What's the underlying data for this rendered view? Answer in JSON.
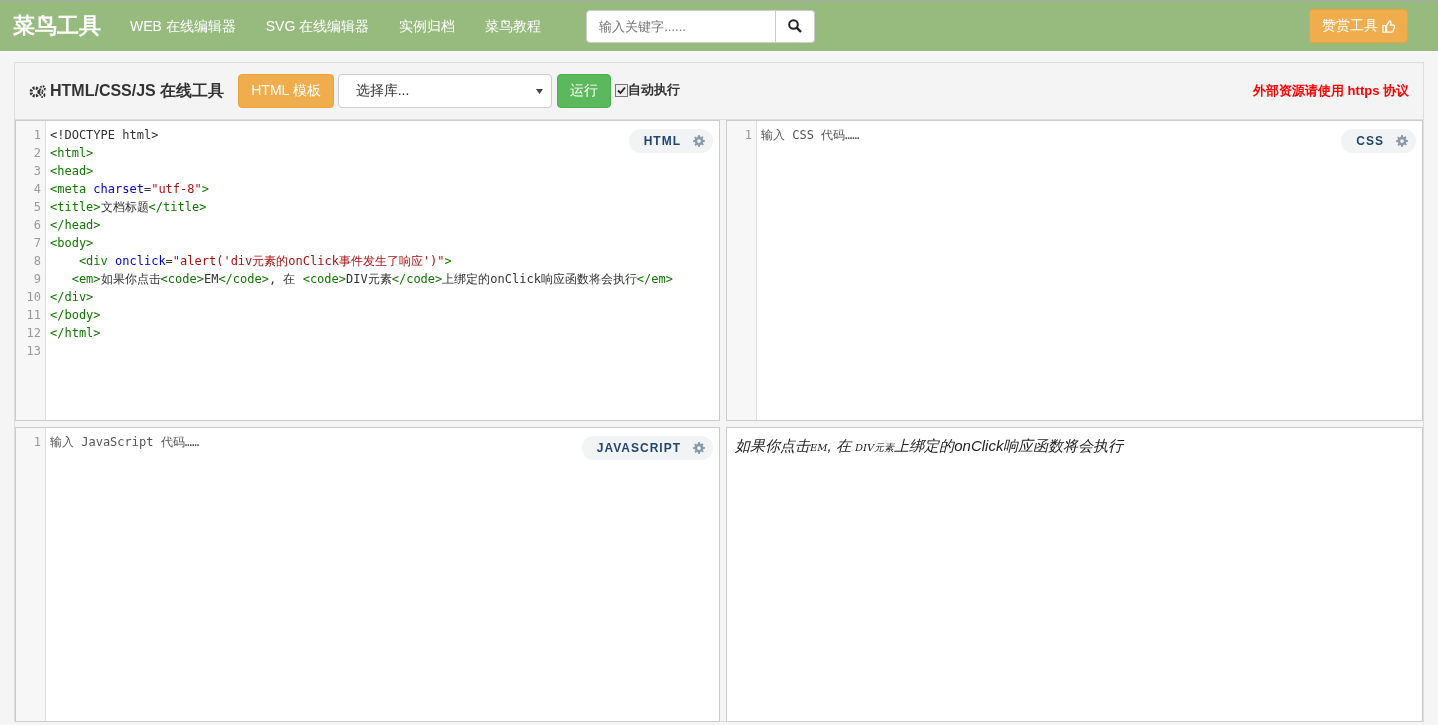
{
  "header": {
    "logo": "菜鸟工具",
    "nav": [
      {
        "label": "WEB 在线编辑器"
      },
      {
        "label": "SVG 在线编辑器"
      },
      {
        "label": "实例归档"
      },
      {
        "label": "菜鸟教程"
      }
    ],
    "search": {
      "placeholder": "输入关键字......"
    },
    "donate_button": "赞赏工具"
  },
  "toolbar": {
    "title": "HTML/CSS/JS 在线工具",
    "template_button": "HTML 模板",
    "library_select": "选择库...",
    "run_button": "运行",
    "auto_run": {
      "label": "自动执行",
      "checked": true
    },
    "notice": "外部资源请使用 https 协议"
  },
  "editors": [
    {
      "label": "HTML",
      "lines": [
        {
          "number": "1",
          "tokens": [
            {
              "kind": "text",
              "text": "<!DOCTYPE html>"
            }
          ]
        },
        {
          "number": "2",
          "tokens": [
            {
              "kind": "tag",
              "text": "<html>"
            }
          ]
        },
        {
          "number": "3",
          "tokens": [
            {
              "kind": "tag",
              "text": "<head>"
            }
          ]
        },
        {
          "number": "4",
          "tokens": [
            {
              "kind": "tag",
              "text": "<meta "
            },
            {
              "kind": "attr",
              "text": "charset"
            },
            {
              "kind": "text",
              "text": "="
            },
            {
              "kind": "string",
              "text": "\"utf-8\""
            },
            {
              "kind": "tag",
              "text": ">"
            }
          ]
        },
        {
          "number": "5",
          "tokens": [
            {
              "kind": "tag",
              "text": "<title>"
            },
            {
              "kind": "text",
              "text": "文档标题"
            },
            {
              "kind": "tag",
              "text": "</title>"
            }
          ]
        },
        {
          "number": "6",
          "tokens": [
            {
              "kind": "tag",
              "text": "</head>"
            }
          ]
        },
        {
          "number": "7",
          "tokens": [
            {
              "kind": "tag",
              "text": "<body>"
            }
          ]
        },
        {
          "number": "8",
          "tokens": [
            {
              "kind": "tag",
              "text": "    <div "
            },
            {
              "kind": "attr",
              "text": "onclick"
            },
            {
              "kind": "text",
              "text": "="
            },
            {
              "kind": "string",
              "text": "\"alert('div元素的onClick事件发生了响应')\""
            },
            {
              "kind": "tag",
              "text": ">"
            }
          ]
        },
        {
          "number": "9",
          "tokens": [
            {
              "kind": "tag",
              "text": "   <em>"
            },
            {
              "kind": "text",
              "text": "如果你点击"
            },
            {
              "kind": "tag",
              "text": "<code>"
            },
            {
              "kind": "text",
              "text": "EM"
            },
            {
              "kind": "tag",
              "text": "</code>"
            },
            {
              "kind": "text",
              "text": ", 在 "
            },
            {
              "kind": "tag",
              "text": "<code>"
            },
            {
              "kind": "text",
              "text": "DIV元素"
            },
            {
              "kind": "tag",
              "text": "</code>"
            },
            {
              "kind": "text",
              "text": "上绑定的onClick响应函数将会执行"
            },
            {
              "kind": "tag",
              "text": "</em>"
            }
          ]
        },
        {
          "number": "10",
          "tokens": [
            {
              "kind": "tag",
              "text": "</div>"
            }
          ]
        },
        {
          "number": "11",
          "tokens": [
            {
              "kind": "tag",
              "text": "</body>"
            }
          ]
        },
        {
          "number": "12",
          "tokens": [
            {
              "kind": "tag",
              "text": "</html>"
            }
          ]
        },
        {
          "number": "13"
        }
      ]
    },
    {
      "label": "CSS",
      "placeholder": "输入 CSS 代码……",
      "lines": [
        {
          "number": "1"
        }
      ]
    },
    {
      "label": "JAVASCRIPT",
      "placeholder": "输入 JavaScript 代码……",
      "lines": [
        {
          "number": "1"
        }
      ]
    }
  ],
  "result": [
    {
      "kind": "text",
      "text": "如果你点击"
    },
    {
      "kind": "code",
      "text": "EM"
    },
    {
      "kind": "text",
      "text": ", 在 "
    },
    {
      "kind": "code",
      "text": "DIV元素"
    },
    {
      "kind": "text",
      "text": "上绑定的onClick响应函数将会执行"
    }
  ]
}
